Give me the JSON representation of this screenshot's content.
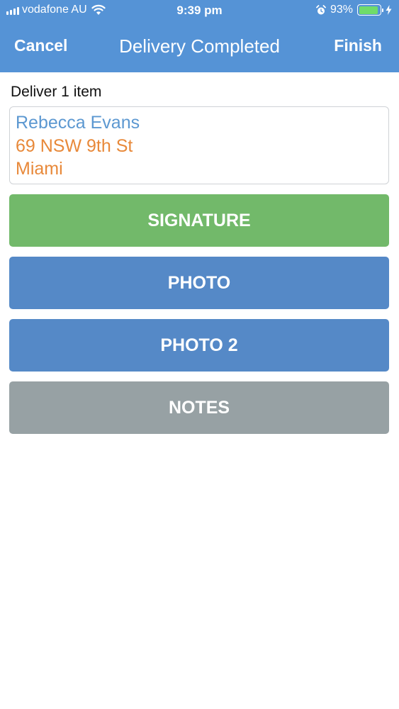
{
  "status_bar": {
    "carrier": "vodafone AU",
    "time": "9:39 pm",
    "battery_percent": "93%",
    "battery_level": 0.93
  },
  "nav": {
    "cancel_label": "Cancel",
    "title": "Delivery Completed",
    "finish_label": "Finish"
  },
  "delivery": {
    "count_label": "Deliver 1 item",
    "recipient_name": "Rebecca Evans",
    "street": "69 NSW 9th St",
    "city": "Miami"
  },
  "actions": {
    "signature": "SIGNATURE",
    "photo": "PHOTO",
    "photo2": "PHOTO 2",
    "notes": "NOTES"
  },
  "colors": {
    "header": "#5593d6",
    "signature": "#72b96a",
    "photo": "#5589c7",
    "notes": "#97a1a4",
    "name": "#5c98d1",
    "address": "#e8893a"
  },
  "icons": [
    "cellular-signal-icon",
    "wifi-icon",
    "alarm-icon",
    "battery-icon",
    "charging-bolt-icon"
  ]
}
